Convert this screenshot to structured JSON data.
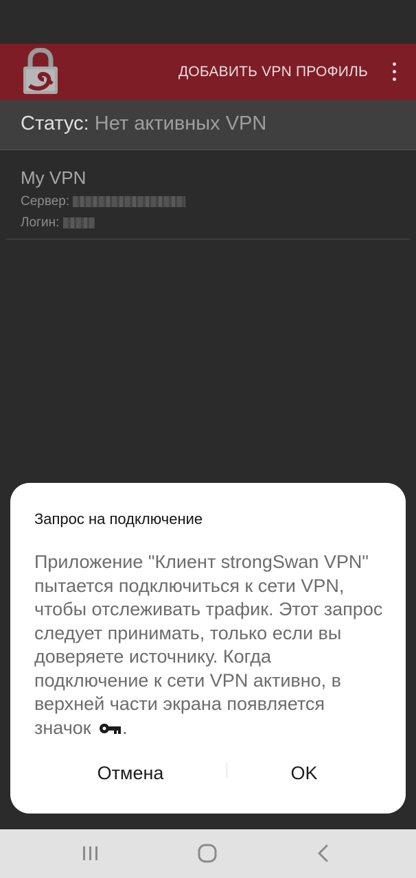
{
  "app_bar": {
    "action_label": "ДОБАВИТЬ VPN ПРОФИЛЬ",
    "logo_icon": "strongswan-lock-logo",
    "menu_icon": "more-vert-icon",
    "color": "#7f1d27"
  },
  "status": {
    "label": "Статус:",
    "value": "Нет активных VPN"
  },
  "profiles": [
    {
      "name": "My VPN",
      "server_label": "Сервер:",
      "login_label": "Логин:"
    }
  ],
  "dialog": {
    "title": "Запрос на подключение",
    "body": "Приложение \"Клиент strongSwan VPN\" пытается подключиться к сети VPN, чтобы отслеживать трафик. Этот запрос следует принимать, только если вы доверяете источнику. Когда подключение к сети VPN активно, в верхней части экрана появляется значок",
    "body_end": ".",
    "inline_icon": "key-icon",
    "cancel_label": "Отмена",
    "ok_label": "OK"
  },
  "nav": {
    "recents_icon": "recent-apps-icon",
    "home_icon": "home-icon",
    "back_icon": "back-icon"
  }
}
